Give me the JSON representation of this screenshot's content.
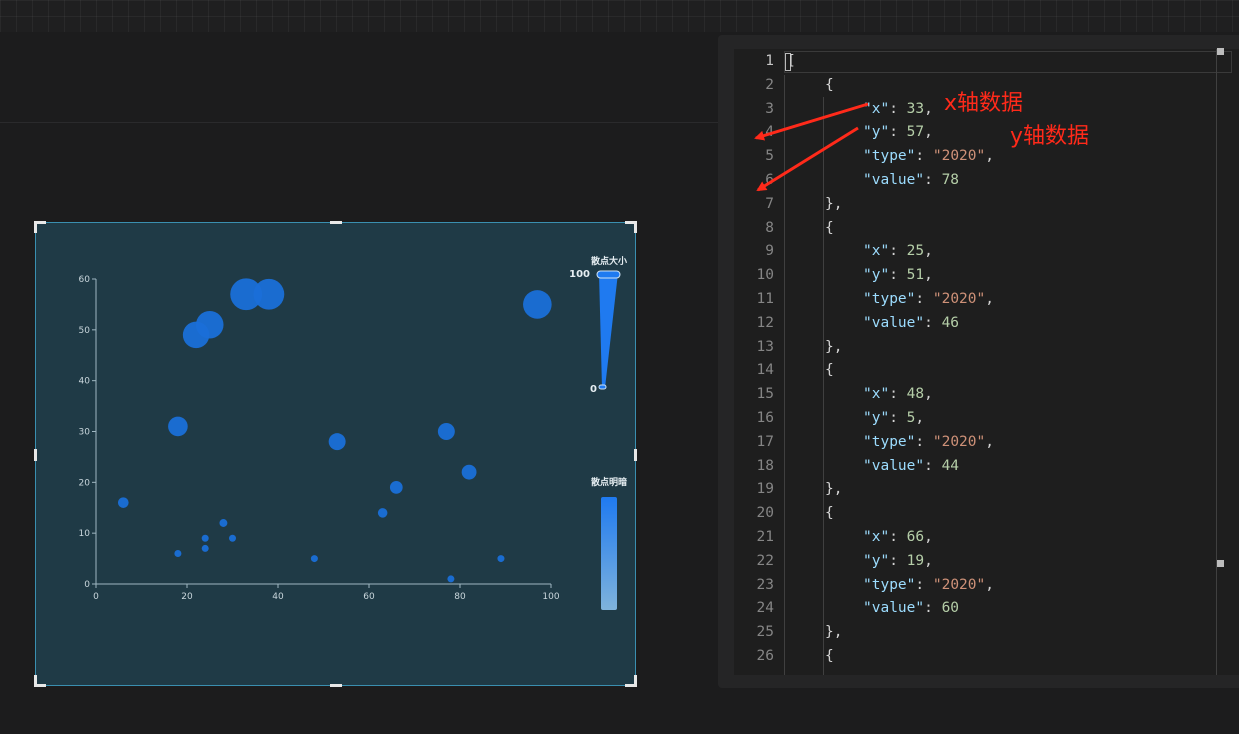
{
  "chart_data": {
    "type": "scatter",
    "xlim": [
      0,
      100
    ],
    "ylim": [
      0,
      60
    ],
    "x_ticks": [
      "0",
      "20",
      "40",
      "60",
      "80",
      "100"
    ],
    "y_ticks": [
      "0",
      "10",
      "20",
      "30",
      "40",
      "50",
      "60"
    ],
    "grid": false,
    "point_color": "#1a6fd8",
    "points": [
      {
        "x": 33,
        "y": 57,
        "value": 78
      },
      {
        "x": 38,
        "y": 57,
        "value": 76
      },
      {
        "x": 25,
        "y": 51,
        "value": 70
      },
      {
        "x": 22,
        "y": 49,
        "value": 68
      },
      {
        "x": 97,
        "y": 55,
        "value": 72
      },
      {
        "x": 18,
        "y": 31,
        "value": 55
      },
      {
        "x": 53,
        "y": 28,
        "value": 50
      },
      {
        "x": 77,
        "y": 30,
        "value": 50
      },
      {
        "x": 82,
        "y": 22,
        "value": 46
      },
      {
        "x": 66,
        "y": 19,
        "value": 42
      },
      {
        "x": 6,
        "y": 16,
        "value": 38
      },
      {
        "x": 63,
        "y": 14,
        "value": 36
      },
      {
        "x": 28,
        "y": 12,
        "value": 33
      },
      {
        "x": 24,
        "y": 9,
        "value": 30
      },
      {
        "x": 30,
        "y": 9,
        "value": 30
      },
      {
        "x": 24,
        "y": 7,
        "value": 28
      },
      {
        "x": 18,
        "y": 6,
        "value": 27
      },
      {
        "x": 48,
        "y": 5,
        "value": 26
      },
      {
        "x": 89,
        "y": 5,
        "value": 26
      },
      {
        "x": 78,
        "y": 1,
        "value": 22
      }
    ],
    "visual_map_size": {
      "title": "散点大小",
      "max_label": "100",
      "min_label": "0"
    },
    "visual_map_opacity": {
      "title": "散点明暗"
    }
  },
  "editor": {
    "lines": [
      {
        "n": "1",
        "tokens": [
          {
            "t": "[",
            "c": "p"
          }
        ],
        "indent": 0
      },
      {
        "n": "2",
        "tokens": [
          {
            "t": "{",
            "c": "p"
          }
        ],
        "indent": 1
      },
      {
        "n": "3",
        "tokens": [
          {
            "t": "\"x\"",
            "c": "k"
          },
          {
            "t": ": ",
            "c": "p"
          },
          {
            "t": "33",
            "c": "n"
          },
          {
            "t": ",",
            "c": "p"
          }
        ],
        "indent": 2
      },
      {
        "n": "4",
        "tokens": [
          {
            "t": "\"y\"",
            "c": "k"
          },
          {
            "t": ": ",
            "c": "p"
          },
          {
            "t": "57",
            "c": "n"
          },
          {
            "t": ",",
            "c": "p"
          }
        ],
        "indent": 2
      },
      {
        "n": "5",
        "tokens": [
          {
            "t": "\"type\"",
            "c": "k"
          },
          {
            "t": ": ",
            "c": "p"
          },
          {
            "t": "\"2020\"",
            "c": "s"
          },
          {
            "t": ",",
            "c": "p"
          }
        ],
        "indent": 2
      },
      {
        "n": "6",
        "tokens": [
          {
            "t": "\"value\"",
            "c": "k"
          },
          {
            "t": ": ",
            "c": "p"
          },
          {
            "t": "78",
            "c": "n"
          }
        ],
        "indent": 2
      },
      {
        "n": "7",
        "tokens": [
          {
            "t": "},",
            "c": "p"
          }
        ],
        "indent": 1
      },
      {
        "n": "8",
        "tokens": [
          {
            "t": "{",
            "c": "p"
          }
        ],
        "indent": 1
      },
      {
        "n": "9",
        "tokens": [
          {
            "t": "\"x\"",
            "c": "k"
          },
          {
            "t": ": ",
            "c": "p"
          },
          {
            "t": "25",
            "c": "n"
          },
          {
            "t": ",",
            "c": "p"
          }
        ],
        "indent": 2
      },
      {
        "n": "10",
        "tokens": [
          {
            "t": "\"y\"",
            "c": "k"
          },
          {
            "t": ": ",
            "c": "p"
          },
          {
            "t": "51",
            "c": "n"
          },
          {
            "t": ",",
            "c": "p"
          }
        ],
        "indent": 2
      },
      {
        "n": "11",
        "tokens": [
          {
            "t": "\"type\"",
            "c": "k"
          },
          {
            "t": ": ",
            "c": "p"
          },
          {
            "t": "\"2020\"",
            "c": "s"
          },
          {
            "t": ",",
            "c": "p"
          }
        ],
        "indent": 2
      },
      {
        "n": "12",
        "tokens": [
          {
            "t": "\"value\"",
            "c": "k"
          },
          {
            "t": ": ",
            "c": "p"
          },
          {
            "t": "46",
            "c": "n"
          }
        ],
        "indent": 2
      },
      {
        "n": "13",
        "tokens": [
          {
            "t": "},",
            "c": "p"
          }
        ],
        "indent": 1
      },
      {
        "n": "14",
        "tokens": [
          {
            "t": "{",
            "c": "p"
          }
        ],
        "indent": 1
      },
      {
        "n": "15",
        "tokens": [
          {
            "t": "\"x\"",
            "c": "k"
          },
          {
            "t": ": ",
            "c": "p"
          },
          {
            "t": "48",
            "c": "n"
          },
          {
            "t": ",",
            "c": "p"
          }
        ],
        "indent": 2
      },
      {
        "n": "16",
        "tokens": [
          {
            "t": "\"y\"",
            "c": "k"
          },
          {
            "t": ": ",
            "c": "p"
          },
          {
            "t": "5",
            "c": "n"
          },
          {
            "t": ",",
            "c": "p"
          }
        ],
        "indent": 2
      },
      {
        "n": "17",
        "tokens": [
          {
            "t": "\"type\"",
            "c": "k"
          },
          {
            "t": ": ",
            "c": "p"
          },
          {
            "t": "\"2020\"",
            "c": "s"
          },
          {
            "t": ",",
            "c": "p"
          }
        ],
        "indent": 2
      },
      {
        "n": "18",
        "tokens": [
          {
            "t": "\"value\"",
            "c": "k"
          },
          {
            "t": ": ",
            "c": "p"
          },
          {
            "t": "44",
            "c": "n"
          }
        ],
        "indent": 2
      },
      {
        "n": "19",
        "tokens": [
          {
            "t": "},",
            "c": "p"
          }
        ],
        "indent": 1
      },
      {
        "n": "20",
        "tokens": [
          {
            "t": "{",
            "c": "p"
          }
        ],
        "indent": 1
      },
      {
        "n": "21",
        "tokens": [
          {
            "t": "\"x\"",
            "c": "k"
          },
          {
            "t": ": ",
            "c": "p"
          },
          {
            "t": "66",
            "c": "n"
          },
          {
            "t": ",",
            "c": "p"
          }
        ],
        "indent": 2
      },
      {
        "n": "22",
        "tokens": [
          {
            "t": "\"y\"",
            "c": "k"
          },
          {
            "t": ": ",
            "c": "p"
          },
          {
            "t": "19",
            "c": "n"
          },
          {
            "t": ",",
            "c": "p"
          }
        ],
        "indent": 2
      },
      {
        "n": "23",
        "tokens": [
          {
            "t": "\"type\"",
            "c": "k"
          },
          {
            "t": ": ",
            "c": "p"
          },
          {
            "t": "\"2020\"",
            "c": "s"
          },
          {
            "t": ",",
            "c": "p"
          }
        ],
        "indent": 2
      },
      {
        "n": "24",
        "tokens": [
          {
            "t": "\"value\"",
            "c": "k"
          },
          {
            "t": ": ",
            "c": "p"
          },
          {
            "t": "60",
            "c": "n"
          }
        ],
        "indent": 2
      },
      {
        "n": "25",
        "tokens": [
          {
            "t": "},",
            "c": "p"
          }
        ],
        "indent": 1
      },
      {
        "n": "26",
        "tokens": [
          {
            "t": "{",
            "c": "p"
          }
        ],
        "indent": 1
      }
    ]
  },
  "annotations": {
    "x_label": "x轴数据",
    "y_label": "y轴数据",
    "color": "#ff2a1a"
  }
}
